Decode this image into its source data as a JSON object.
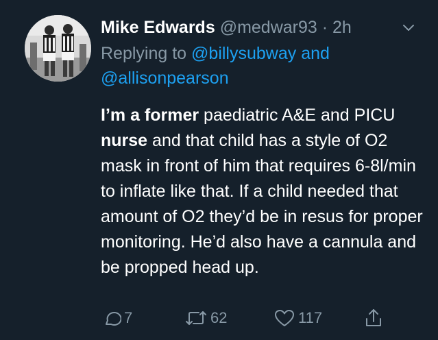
{
  "tweet": {
    "author_name": "Mike Edwards",
    "author_handle": "@medwar93",
    "separator": "·",
    "time": "2h",
    "replying_prefix": "Replying to ",
    "replying_mention_1": "@billysubway",
    "replying_and": " and",
    "replying_mention_2": "@allisonpearson",
    "body": {
      "bold_1": "I’m a former",
      "text_1": " paediatric A&E and PICU ",
      "bold_2": "nurse",
      "text_2": " and that child has a style of O2 mask in front of him that requires 6-8l/min to inflate like that. If a child needed that amount of O2 they’d be in resus for proper monitoring. He’d also have a cannula and be propped head up."
    }
  },
  "actions": {
    "reply_count": "7",
    "retweet_count": "62",
    "like_count": "117"
  },
  "icons": {
    "menu": "chevron-down-icon",
    "reply": "reply-icon",
    "retweet": "retweet-icon",
    "like": "heart-icon",
    "share": "share-icon"
  },
  "colors": {
    "background": "#15202b",
    "secondary_text": "#8899a6",
    "link": "#1da1f2",
    "primary_text": "#ffffff"
  }
}
